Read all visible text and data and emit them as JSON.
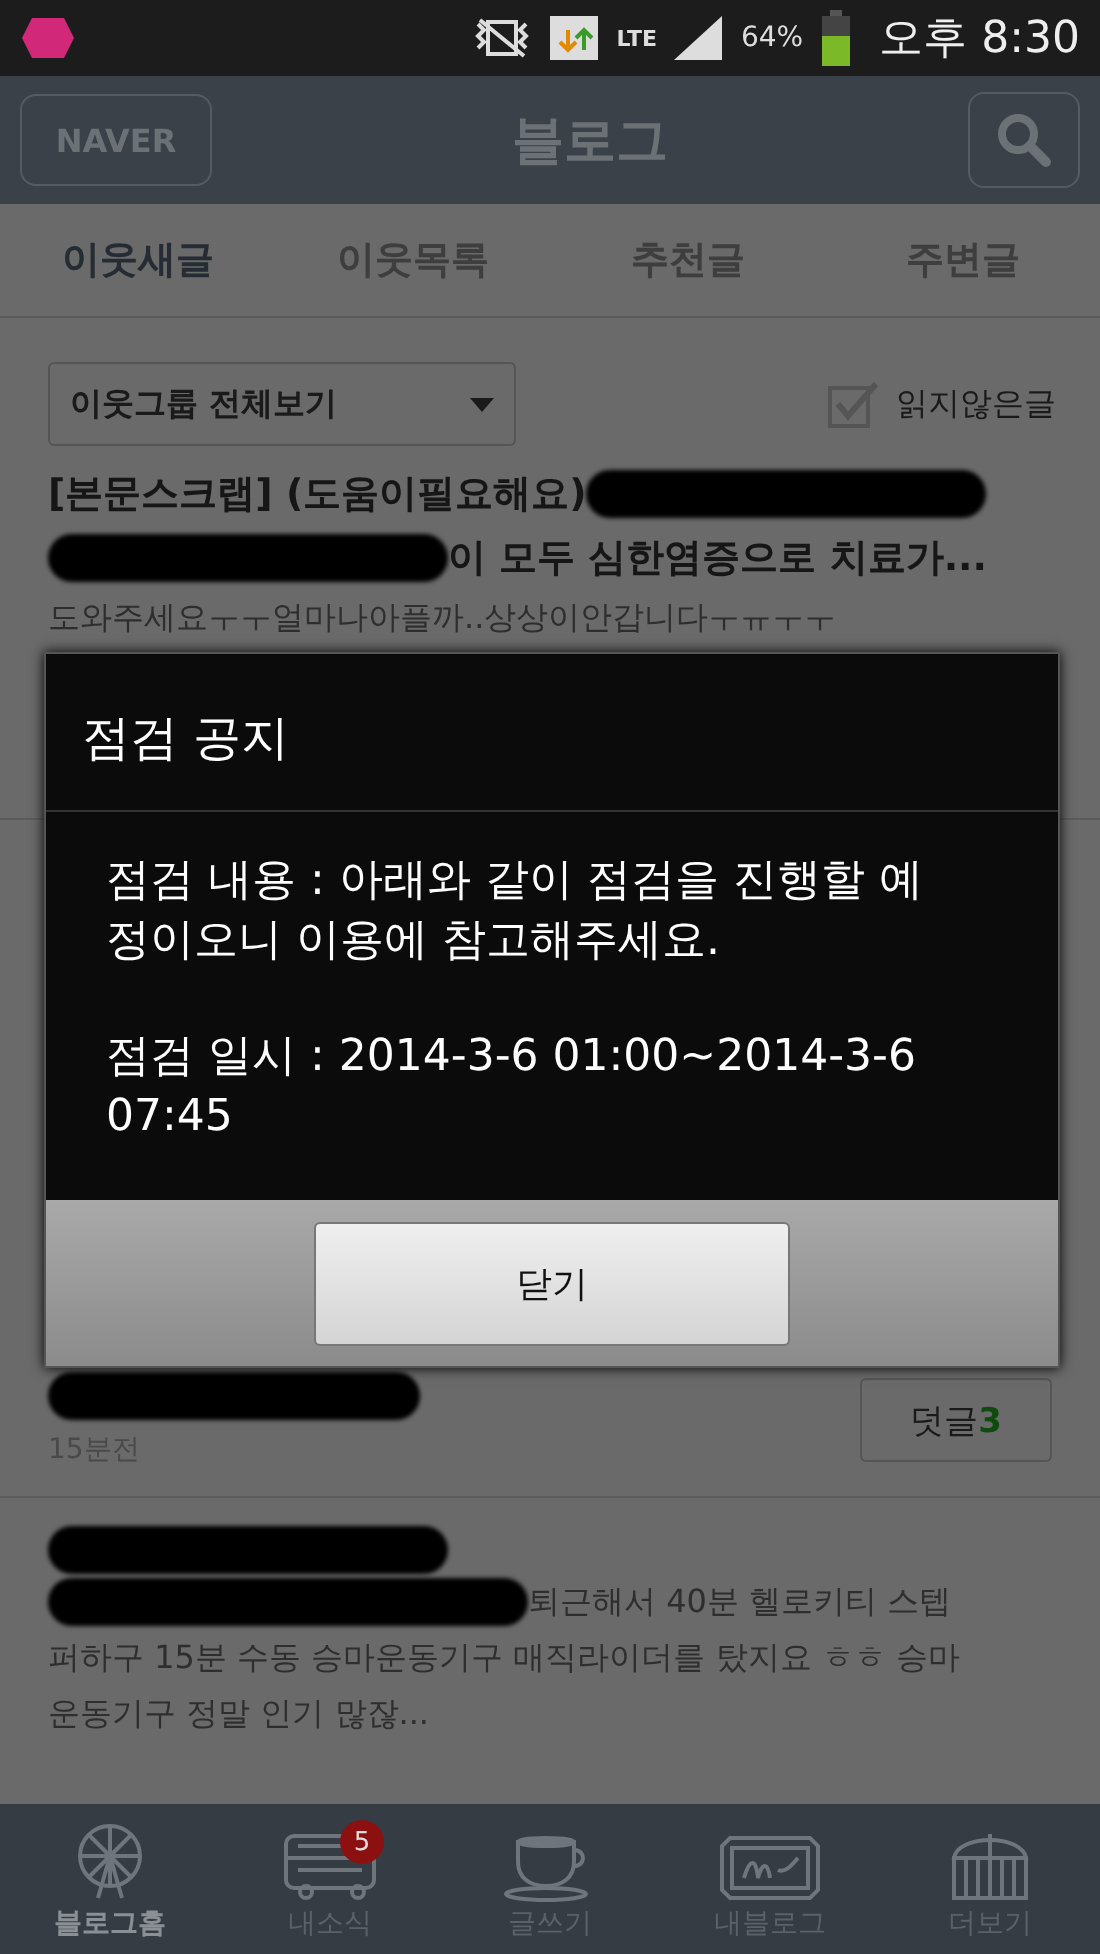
{
  "status_bar": {
    "network": "LTE",
    "battery_text": "64%",
    "time": "오후 8:30"
  },
  "header": {
    "logo_button": "NAVER",
    "title": "블로그"
  },
  "tabs": [
    {
      "label": "이웃새글",
      "selected": true
    },
    {
      "label": "이웃목록",
      "selected": false
    },
    {
      "label": "추천글",
      "selected": false
    },
    {
      "label": "주변글",
      "selected": false
    }
  ],
  "filter": {
    "dropdown": "이웃그룹 전체보기",
    "unread_checkbox": {
      "label": "읽지않은글",
      "checked": true
    }
  },
  "posts": [
    {
      "title_lines": [
        [
          {
            "kind": "text",
            "text": "[본문스크랩] (도움이필요해요)"
          },
          {
            "kind": "redacted"
          }
        ],
        [
          {
            "kind": "redacted"
          },
          {
            "kind": "text",
            "text": "이 모두 심한염증으로 치료가..."
          }
        ]
      ],
      "preview_lines": [
        [
          {
            "kind": "text",
            "text": "도와주세요ㅜㅜ얼마나아플까..상상이안갑니다ㅜㅠㅜㅜ"
          }
        ]
      ]
    },
    {
      "footer": {
        "time": "15분전",
        "comment_label": "덧글",
        "comment_count": "3"
      }
    },
    {
      "title_lines": [
        [
          {
            "kind": "redacted"
          }
        ]
      ],
      "preview_lines": [
        [
          {
            "kind": "redacted"
          },
          {
            "kind": "text",
            "text": "퇴근해서 40분 헬로키티 스텝"
          }
        ],
        [
          {
            "kind": "text",
            "text": "퍼하구 15분 수동 승마운동기구 매직라이더를 탔지요 ㅎㅎ 승마"
          }
        ],
        [
          {
            "kind": "text",
            "text": "운동기구 정말 인기 많잖..."
          }
        ]
      ]
    }
  ],
  "dialog": {
    "title": "점검 공지",
    "paragraphs": [
      "점검 내용 : 아래와 같이 점검을 진행할 예정이오니 이용에 참고해주세요.",
      "점검 일시 : 2014-3-6 01:00~2014-3-6 07:45"
    ],
    "button": "닫기"
  },
  "bottom_nav": [
    {
      "kind": "wheel",
      "label": "블로그홈",
      "selected": true
    },
    {
      "kind": "bus",
      "label": "내소식",
      "selected": false,
      "badge": "5"
    },
    {
      "kind": "cup",
      "label": "글쓰기",
      "selected": false
    },
    {
      "kind": "sign",
      "label": "내블로그",
      "selected": false
    },
    {
      "kind": "dome",
      "label": "더보기",
      "selected": false
    }
  ]
}
